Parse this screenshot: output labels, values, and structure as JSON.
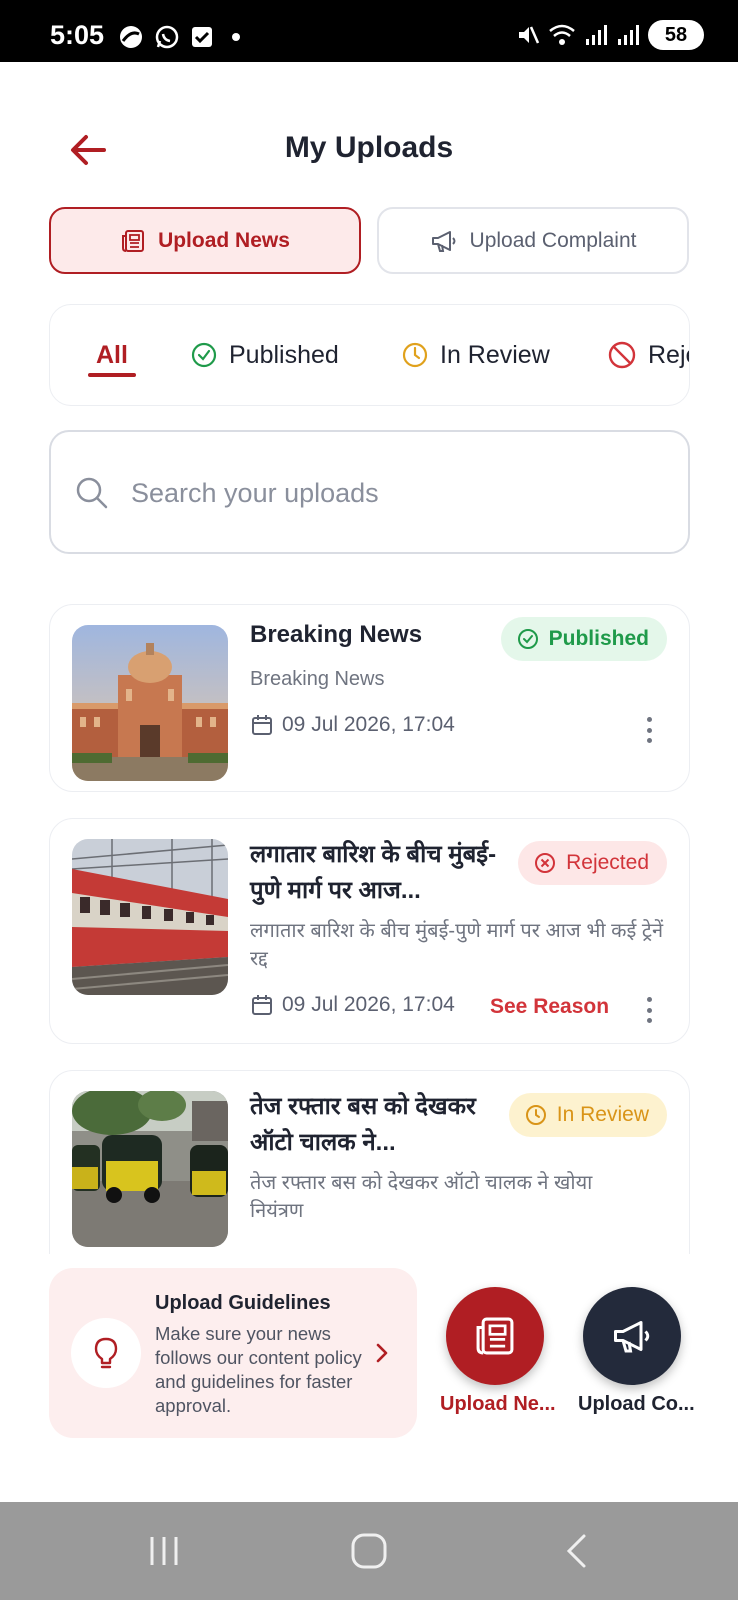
{
  "status_bar": {
    "time": "5:05",
    "battery": "58"
  },
  "header": {
    "title": "My Uploads"
  },
  "toggle": {
    "news_label": "Upload News",
    "complaint_label": "Upload Complaint"
  },
  "filters": {
    "all": "All",
    "published": "Published",
    "in_review": "In Review",
    "rejected": "Rejected"
  },
  "search": {
    "placeholder": "Search your uploads",
    "value": ""
  },
  "uploads": [
    {
      "title": "Breaking News",
      "subtitle": "Breaking News",
      "date": "09 Jul 2026, 17:04",
      "status": "Published",
      "thumb": "government-building-photo"
    },
    {
      "title": "लगातार बारिश के बीच मुंबई-पुणे मार्ग पर आज...",
      "subtitle": "लगातार बारिश के बीच मुंबई-पुणे मार्ग पर आज भी कई ट्रेनें रद्द",
      "date": "09 Jul 2026, 17:04",
      "status": "Rejected",
      "action": "See Reason",
      "thumb": "train-photo"
    },
    {
      "title": "तेज रफ्तार बस को देखकर ऑटो चालक ने...",
      "subtitle": "तेज रफ्तार बस को देखकर ऑटो चालक ने खोया नियंत्रण",
      "status": "In Review",
      "thumb": "auto-rickshaw-photo"
    }
  ],
  "guidelines": {
    "title": "Upload Guidelines",
    "text": "Make sure your news follows our content policy and guidelines for faster approval."
  },
  "fabs": {
    "news_label": "Upload Ne...",
    "complaint_label": "Upload Co..."
  },
  "colors": {
    "brand": "#b01e23",
    "published": "#1f9a4a",
    "rejected": "#d2343a",
    "review": "#d99418",
    "dark": "#232a3b"
  }
}
